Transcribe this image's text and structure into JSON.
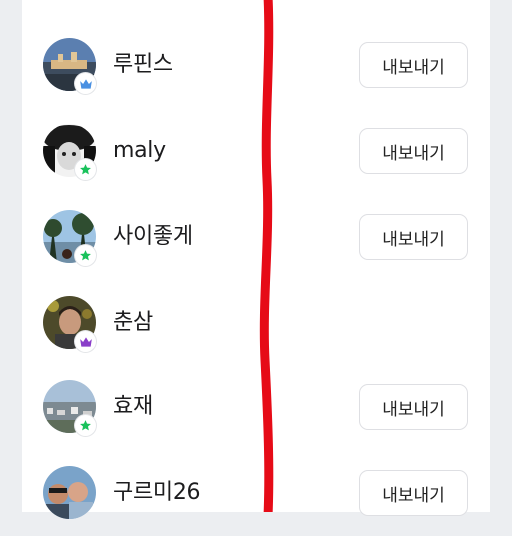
{
  "accent": "#e60b17",
  "list": {
    "rows": [
      {
        "name": "",
        "badge": "star",
        "button": ""
      },
      {
        "name": "루핀스",
        "badge": "crown-blue",
        "button": "내보내기"
      },
      {
        "name": "maly",
        "badge": "star",
        "button": "내보내기"
      },
      {
        "name": "사이좋게",
        "badge": "star",
        "button": "내보내기"
      },
      {
        "name": "춘삼",
        "badge": "crown-purple",
        "button": ""
      },
      {
        "name": "효재",
        "badge": "star",
        "button": "내보내기"
      },
      {
        "name": "구르미26",
        "badge": "",
        "button": "내보내기"
      }
    ]
  }
}
